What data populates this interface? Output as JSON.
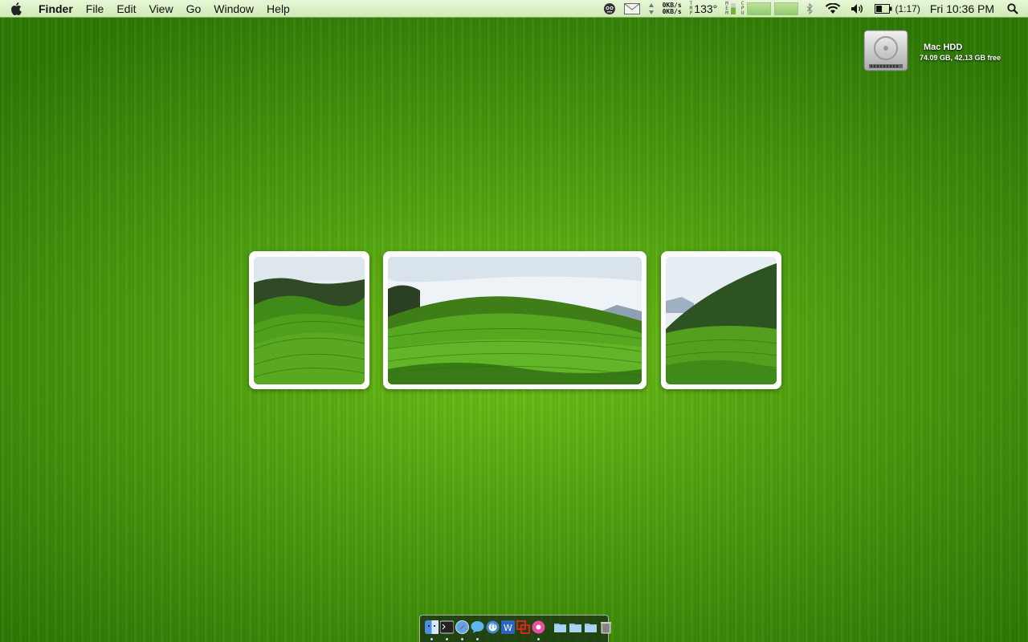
{
  "menubar": {
    "app_name": "Finder",
    "menus": [
      "File",
      "Edit",
      "View",
      "Go",
      "Window",
      "Help"
    ],
    "net_up": "0KB/s",
    "net_down": "0KB/s",
    "tmp_label": [
      "T",
      "M",
      "P"
    ],
    "temperature": "133°",
    "mem_label": [
      "M",
      "E",
      "M"
    ],
    "cpu_label": [
      "C",
      "P",
      "U"
    ],
    "battery_time": "(1:17)",
    "clock": "Fri 10:36 PM"
  },
  "desktop": {
    "drive_name": "Mac HDD",
    "drive_info": "74.09 GB, 42.13 GB free"
  },
  "colors": {
    "menubar_top": "#e8f7d8",
    "desktop_green": "#4fa010"
  },
  "dock": {
    "apps": [
      "finder-icon",
      "terminal-icon",
      "safari-icon",
      "ichat-icon",
      "itunes-icon",
      "word-icon",
      "parallels-icon",
      "itunes-pink-icon"
    ],
    "folders": [
      "applications-folder-icon",
      "documents-folder-icon",
      "downloads-folder-icon",
      "trash-icon"
    ]
  }
}
